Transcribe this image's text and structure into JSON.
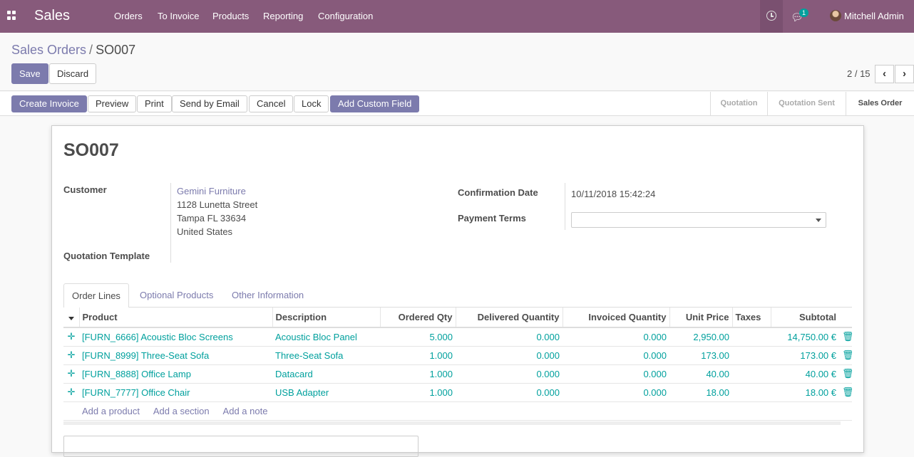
{
  "nav": {
    "app_name": "Sales",
    "menu": [
      "Orders",
      "To Invoice",
      "Products",
      "Reporting",
      "Configuration"
    ],
    "chat_count": "1",
    "user_name": "Mitchell Admin",
    "icons": {
      "apps": "apps-grid-icon",
      "activity": "clock-icon",
      "messages": "chat-icon"
    }
  },
  "breadcrumb": {
    "parent": "Sales Orders",
    "separator": "/",
    "current": "SO007"
  },
  "controls": {
    "save": "Save",
    "discard": "Discard",
    "pager": "2 / 15"
  },
  "actions": [
    "Create Invoice",
    "Preview",
    "Print",
    "Send by Email",
    "Cancel",
    "Lock",
    "Add Custom Field"
  ],
  "stages": [
    "Quotation",
    "Quotation Sent",
    "Sales Order"
  ],
  "active_stage": "Sales Order",
  "form": {
    "title": "SO007",
    "customer_label": "Customer",
    "customer_name": "Gemini Furniture",
    "customer_address": [
      "1128 Lunetta Street",
      "Tampa FL 33634",
      "United States"
    ],
    "quotation_template_label": "Quotation Template",
    "confirmation_date_label": "Confirmation Date",
    "confirmation_date": "10/11/2018 15:42:24",
    "payment_terms_label": "Payment Terms",
    "payment_terms_value": ""
  },
  "tabs": [
    "Order Lines",
    "Optional Products",
    "Other Information"
  ],
  "table": {
    "columns": [
      "Product",
      "Description",
      "Ordered Qty",
      "Delivered Quantity",
      "Invoiced Quantity",
      "Unit Price",
      "Taxes",
      "Subtotal"
    ],
    "rows": [
      [
        "[FURN_6666] Acoustic Bloc Screens",
        "Acoustic Bloc Panel",
        "5.000",
        "0.000",
        "0.000",
        "2,950.00",
        "",
        "14,750.00 €"
      ],
      [
        "[FURN_8999] Three-Seat Sofa",
        "Three-Seat Sofa",
        "1.000",
        "0.000",
        "0.000",
        "173.00",
        "",
        "173.00 €"
      ],
      [
        "[FURN_8888] Office Lamp",
        "Datacard",
        "1.000",
        "0.000",
        "0.000",
        "40.00",
        "",
        "40.00 €"
      ],
      [
        "[FURN_7777] Office Chair",
        "USB Adapter",
        "1.000",
        "0.000",
        "0.000",
        "18.00",
        "",
        "18.00 €"
      ]
    ],
    "add_links": [
      "Add a product",
      "Add a section",
      "Add a note"
    ]
  },
  "colors": {
    "navbar": "#875a7b",
    "primary": "#7c7bad",
    "teal": "#00a09d"
  }
}
